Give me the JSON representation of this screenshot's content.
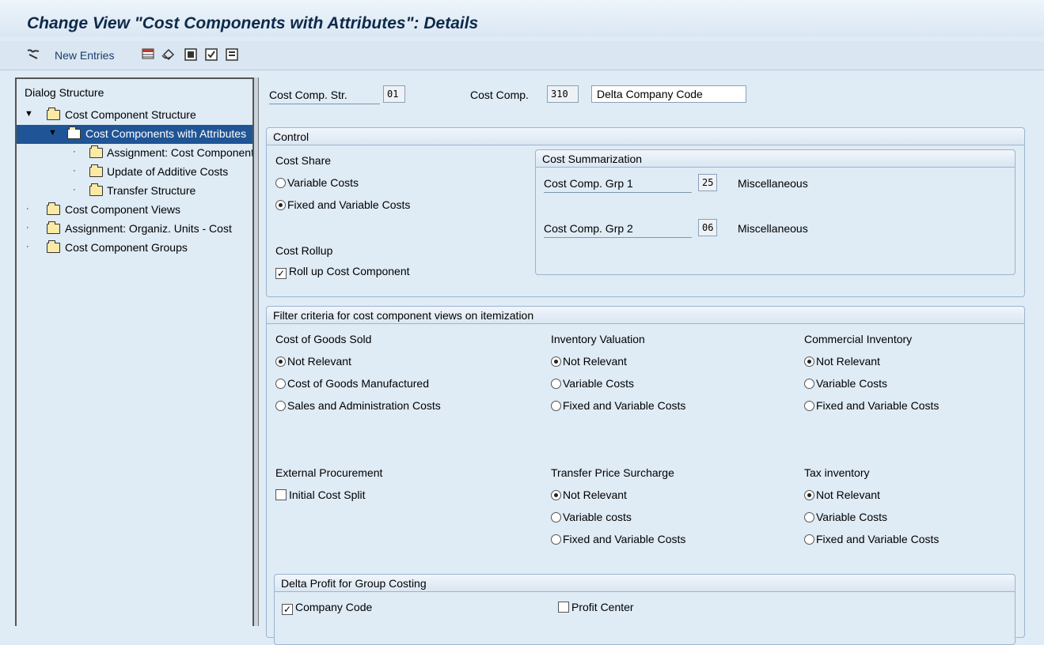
{
  "title": "Change View \"Cost Components with Attributes\": Details",
  "toolbar": {
    "new_entries": "New Entries",
    "icons": [
      "glasses-icon",
      "table-icon",
      "undo-icon",
      "select-all-icon",
      "select-block-icon",
      "deselect-all-icon"
    ]
  },
  "dialog": {
    "header": "Dialog Structure",
    "items": [
      {
        "label": "Cost Component Structure"
      },
      {
        "label": "Cost Components with Attributes"
      },
      {
        "label": "Assignment: Cost Component"
      },
      {
        "label": "Update of Additive Costs"
      },
      {
        "label": "Transfer Structure"
      },
      {
        "label": "Cost Component Views"
      },
      {
        "label": "Assignment: Organiz. Units - Cost"
      },
      {
        "label": "Cost Component Groups"
      }
    ]
  },
  "header_fields": {
    "cost_comp_str_label": "Cost Comp. Str.",
    "cost_comp_str_value": "01",
    "cost_comp_label": "Cost Comp.",
    "cost_comp_value": "310",
    "cost_comp_desc": "Delta Company Code"
  },
  "control": {
    "title": "Control",
    "cost_share_label": "Cost Share",
    "variable_costs": "Variable Costs",
    "fixed_variable_costs": "Fixed and Variable Costs",
    "cost_share_selected": "Fixed and Variable Costs",
    "cost_rollup_label": "Cost Rollup",
    "roll_up": "Roll up Cost Component",
    "roll_up_checked": true,
    "summarization": {
      "title": "Cost Summarization",
      "grp1_label": "Cost Comp. Grp 1",
      "grp1_value": "25",
      "grp1_text": "Miscellaneous",
      "grp2_label": "Cost Comp. Grp 2",
      "grp2_value": "06",
      "grp2_text": "Miscellaneous"
    }
  },
  "filter": {
    "title": "Filter criteria for cost component views on itemization",
    "cogs": {
      "label": "Cost of Goods Sold",
      "options": [
        "Not Relevant",
        "Cost of Goods Manufactured",
        "Sales and Administration Costs"
      ],
      "selected": 0
    },
    "inv_val": {
      "label": "Inventory Valuation",
      "options": [
        "Not Relevant",
        "Variable Costs",
        "Fixed and Variable Costs"
      ],
      "selected": 0
    },
    "comm_inv": {
      "label": "Commercial Inventory",
      "options": [
        "Not Relevant",
        "Variable Costs",
        "Fixed and Variable Costs"
      ],
      "selected": 0
    },
    "ext_proc": {
      "label": "External Procurement",
      "checkbox": "Initial Cost Split",
      "checked": false
    },
    "tps": {
      "label": "Transfer Price Surcharge",
      "options": [
        "Not Relevant",
        "Variable costs",
        "Fixed and Variable Costs"
      ],
      "selected": 0
    },
    "tax_inv": {
      "label": "Tax inventory",
      "options": [
        "Not Relevant",
        "Variable Costs",
        "Fixed and Variable Costs"
      ],
      "selected": 0
    },
    "delta": {
      "title": "Delta Profit for Group Costing",
      "company_code": "Company Code",
      "company_code_checked": true,
      "profit_center": "Profit Center",
      "profit_center_checked": false
    }
  }
}
